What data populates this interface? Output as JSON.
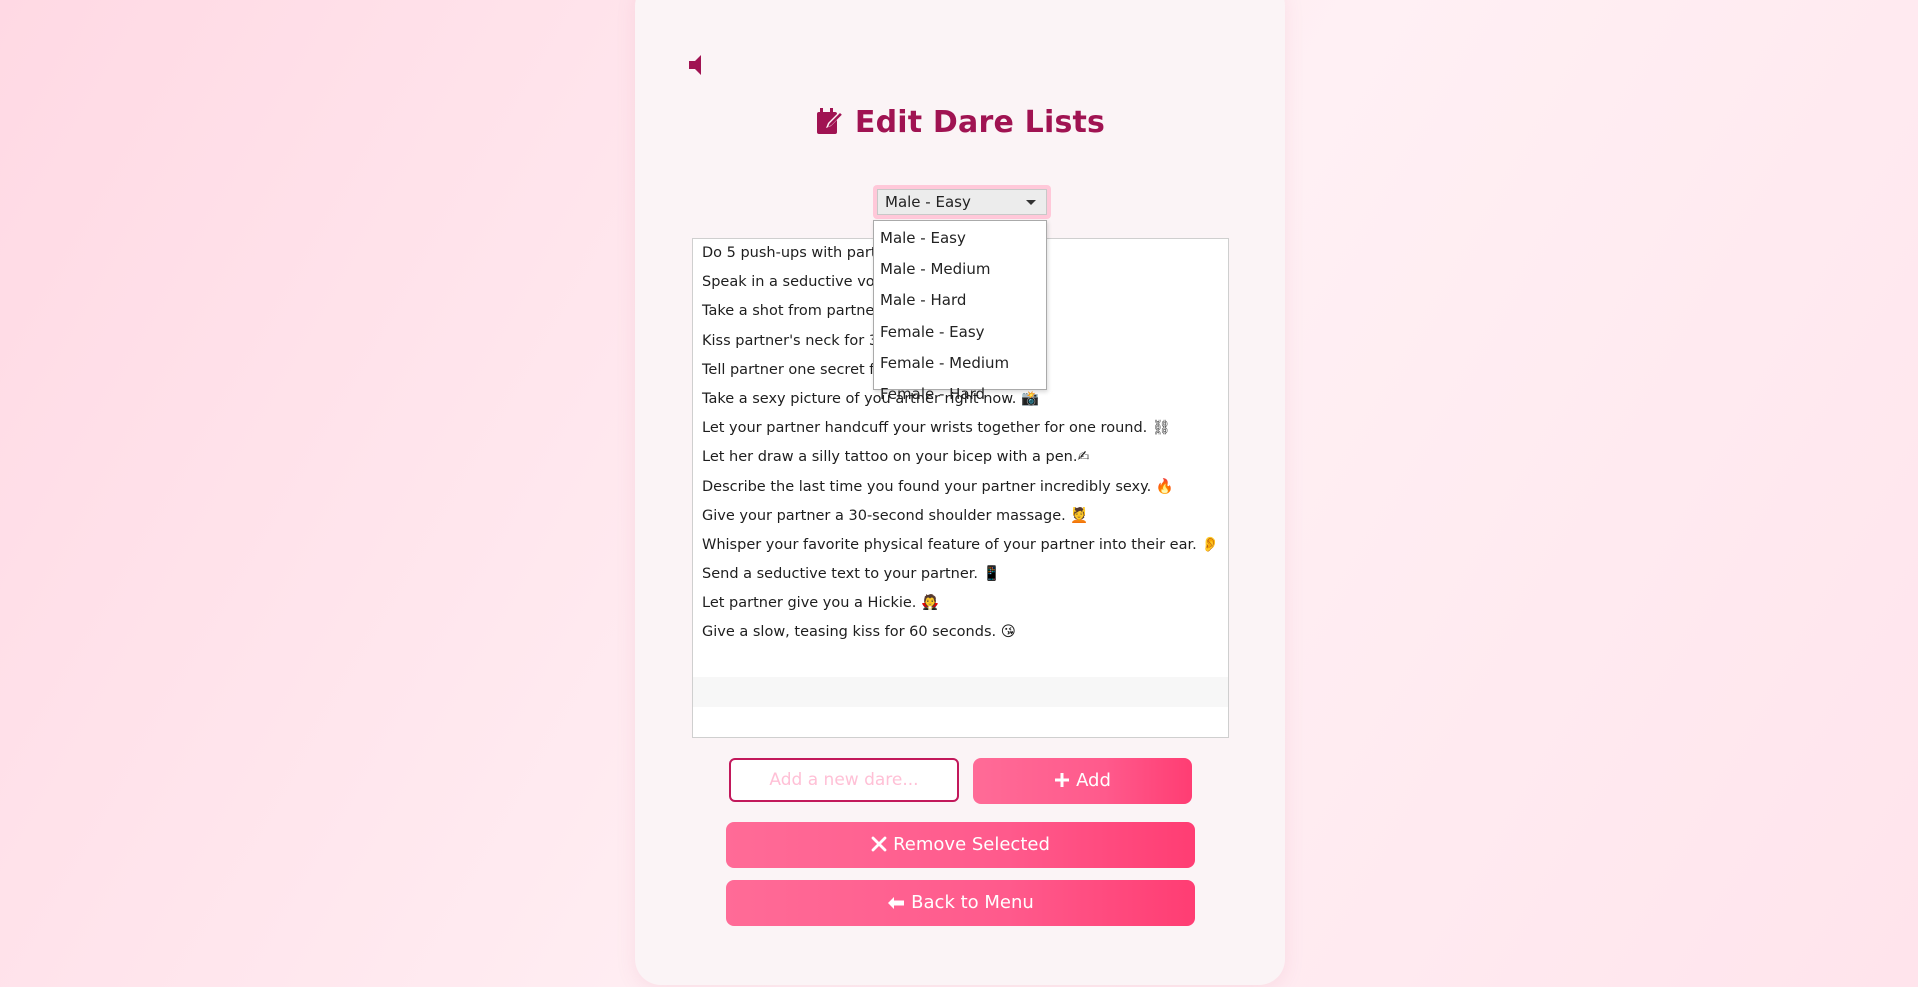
{
  "title": "Edit Dare Lists",
  "category_select": {
    "selected": "Male - Easy",
    "options": [
      "Male - Easy",
      "Male - Medium",
      "Male - Hard",
      "Female - Easy",
      "Female - Medium",
      "Female - Hard"
    ]
  },
  "dares": [
    "Do 5 push-ups with partne",
    "Speak in a seductive voice",
    "Take a shot from partner's",
    "Kiss partner's neck for 30 s                                    r hands. 💋",
    "Tell partner one secret fan                                    🔥",
    "Take a sexy picture of you                                    artner right now. 📸",
    "Let your partner handcuff your wrists together for one round. ⛓",
    "Let her draw a silly tattoo on your bicep with a pen.✍",
    "Describe the last time you found your partner incredibly sexy. 🔥",
    "Give your partner a 30-second shoulder massage. 💆",
    "Whisper your favorite physical feature of your partner into their ear. 👂",
    "Send a seductive text to your partner. 📱",
    "Let partner give you a Hickie. 🧛",
    "Give a slow, teasing kiss for 60 seconds. 😘"
  ],
  "new_dare_input": {
    "value": "",
    "placeholder": "Add a new dare..."
  },
  "buttons": {
    "add": "Add",
    "remove": "Remove Selected",
    "back": "Back to Menu"
  },
  "icons": {
    "sound": "volume-icon",
    "title": "edit-note-icon",
    "add": "plus-icon",
    "remove": "x-icon",
    "back": "arrow-left-icon"
  },
  "colors": {
    "accent": "#a01352",
    "button": "#ff5a8c",
    "input_border": "#c2185b"
  }
}
